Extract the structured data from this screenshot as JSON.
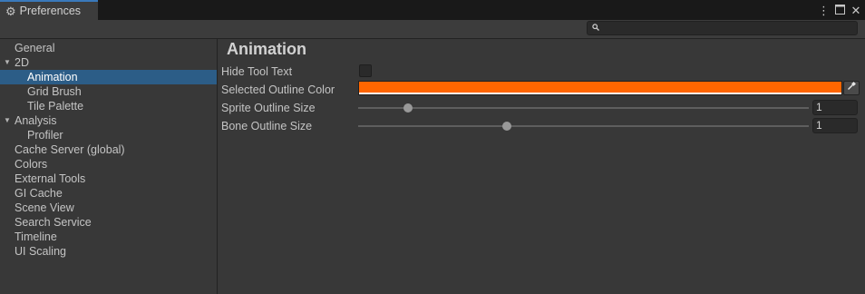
{
  "window": {
    "tab_title": "Preferences",
    "tab_icon": "gear-icon",
    "controls": [
      "kebab-menu-icon",
      "maximize-icon",
      "close-icon"
    ]
  },
  "search": {
    "value": "",
    "placeholder": ""
  },
  "sidebar": {
    "items": [
      {
        "label": "General",
        "indent": 0,
        "expandable": false,
        "selected": false
      },
      {
        "label": "2D",
        "indent": 0,
        "expandable": true,
        "expanded": true,
        "selected": false
      },
      {
        "label": "Animation",
        "indent": 1,
        "expandable": false,
        "selected": true
      },
      {
        "label": "Grid Brush",
        "indent": 1,
        "expandable": false,
        "selected": false
      },
      {
        "label": "Tile Palette",
        "indent": 1,
        "expandable": false,
        "selected": false
      },
      {
        "label": "Analysis",
        "indent": 0,
        "expandable": true,
        "expanded": true,
        "selected": false
      },
      {
        "label": "Profiler",
        "indent": 1,
        "expandable": false,
        "selected": false
      },
      {
        "label": "Cache Server (global)",
        "indent": 0,
        "expandable": false,
        "selected": false
      },
      {
        "label": "Colors",
        "indent": 0,
        "expandable": false,
        "selected": false
      },
      {
        "label": "External Tools",
        "indent": 0,
        "expandable": false,
        "selected": false
      },
      {
        "label": "GI Cache",
        "indent": 0,
        "expandable": false,
        "selected": false
      },
      {
        "label": "Scene View",
        "indent": 0,
        "expandable": false,
        "selected": false
      },
      {
        "label": "Search Service",
        "indent": 0,
        "expandable": false,
        "selected": false
      },
      {
        "label": "Timeline",
        "indent": 0,
        "expandable": false,
        "selected": false
      },
      {
        "label": "UI Scaling",
        "indent": 0,
        "expandable": false,
        "selected": false
      }
    ]
  },
  "main": {
    "title": "Animation",
    "hide_tool_text": {
      "label": "Hide Tool Text",
      "checked": false
    },
    "selected_outline_color": {
      "label": "Selected Outline Color",
      "color": "#ff6600",
      "alpha": 1.0
    },
    "sprite_outline_size": {
      "label": "Sprite Outline Size",
      "value": "1",
      "slider_fraction": 0.11
    },
    "bone_outline_size": {
      "label": "Bone Outline Size",
      "value": "1",
      "slider_fraction": 0.33
    }
  },
  "colors": {
    "accent": "#3a79bb",
    "selection": "#2c5d87",
    "background": "#383838"
  }
}
